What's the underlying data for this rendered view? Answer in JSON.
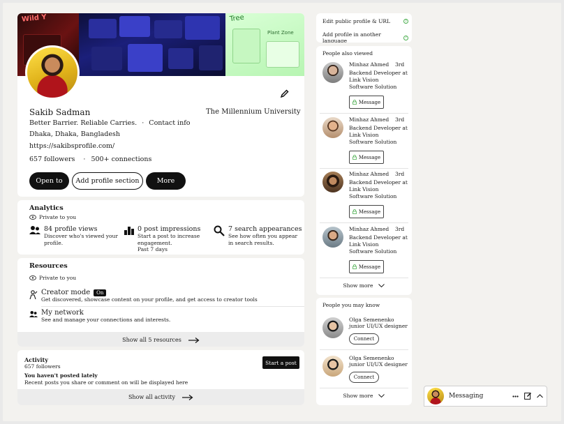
{
  "profile": {
    "name": "Sakib Sadman",
    "school": "The Millennium University",
    "headline": "Better Barrier. Reliable Carries.",
    "contact_info": "Contact info",
    "location": "Dhaka, Dhaka, Bangladesh",
    "website": "https://sakibsprofile.com/",
    "followers": "657 followers",
    "connections": "500+ connections",
    "buttons": {
      "open_to": "Open to",
      "add_section": "Add profile section",
      "more": "More"
    },
    "banner_texts": [
      "Wild Y",
      "Tree",
      "Plant Zone"
    ]
  },
  "analytics": {
    "title": "Analytics",
    "private": "Private to you",
    "metrics": [
      {
        "icon": "people-icon",
        "title": "84 profile views",
        "sub": [
          "Discover who's viewed your",
          "profile."
        ]
      },
      {
        "icon": "bar-chart-icon",
        "title": "0 post impressions",
        "sub": [
          "Start a post to increase",
          "engagement.",
          "Past 7 days"
        ]
      },
      {
        "icon": "search-icon",
        "title": "7 search appearances",
        "sub": [
          "See how often you appear",
          "in search results."
        ]
      }
    ]
  },
  "resources": {
    "title": "Resources",
    "private": "Private to you",
    "creator_mode": {
      "title": "Creator mode",
      "badge": "On",
      "sub": "Get discovered, showcase content on your profile, and get access to creator tools"
    },
    "network": {
      "title": "My network",
      "sub": "See and manage your connections and interests."
    },
    "show_all": "Show all 5 resources"
  },
  "activity": {
    "title": "Activity",
    "followers": "657 followers",
    "none": "You haven't posted lately",
    "desc": "Recent posts you share or comment on will be displayed here",
    "start_post": "Start a post",
    "show_all": "Show all activity"
  },
  "sidebar": {
    "links": [
      "Edit public profile & URL",
      "Add profile in another language"
    ],
    "also_viewed": {
      "title": "People also viewed",
      "people": [
        {
          "name": "Minhaz Ahmed",
          "degree": "3rd",
          "role": [
            "Backend Developer at",
            "Link Vision",
            "Software Solution"
          ],
          "action": "Message"
        },
        {
          "name": "Minhaz Ahmed",
          "degree": "3rd",
          "role": [
            "Backend Developer at",
            "Link Vision",
            "Software Solution"
          ],
          "action": "Message"
        },
        {
          "name": "Minhaz Ahmed",
          "degree": "3rd",
          "role": [
            "Backend Developer at",
            "Link Vision",
            "Software Solution"
          ],
          "action": "Message"
        },
        {
          "name": "Minhaz Ahmed",
          "degree": "3rd",
          "role": [
            "Backend Developer at",
            "Link Vision",
            "Software Solution"
          ],
          "action": "Message"
        }
      ],
      "show_more": "Show more"
    },
    "may_know": {
      "title": "People you may know",
      "people": [
        {
          "name": "Olga Semenenko",
          "role": [
            "junior UI/UX designer"
          ],
          "action": "Connect"
        },
        {
          "name": "Olga Semenenko",
          "role": [
            "junior UI/UX designer"
          ],
          "action": "Connect"
        }
      ],
      "show_more": "Show more"
    }
  },
  "messaging": {
    "title": "Messaging"
  },
  "colors": {
    "dark": "#111111",
    "accent_green": "#4caf50",
    "card": "#ffffff",
    "page": "#f3f2ef"
  }
}
